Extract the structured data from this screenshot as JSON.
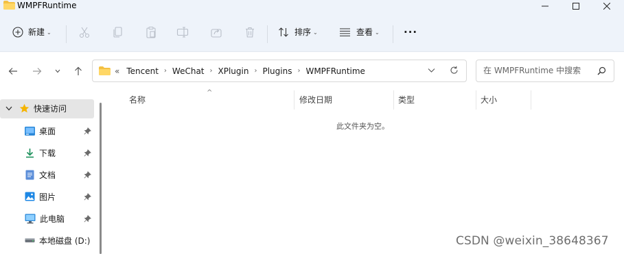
{
  "window": {
    "title": "WMPFRuntime"
  },
  "toolbar": {
    "new_label": "新建",
    "sort_label": "排序",
    "view_label": "查看",
    "more_label": "···"
  },
  "address": {
    "overflow": "«",
    "crumbs": [
      "Tencent",
      "WeChat",
      "XPlugin",
      "Plugins",
      "WMPFRuntime"
    ]
  },
  "search": {
    "placeholder": "在 WMPFRuntime 中搜索"
  },
  "sidebar": {
    "quick_access": "快速访问",
    "items": [
      {
        "label": "桌面",
        "icon": "desktop-icon",
        "pinned": true
      },
      {
        "label": "下载",
        "icon": "download-icon",
        "pinned": true
      },
      {
        "label": "文档",
        "icon": "document-icon",
        "pinned": true
      },
      {
        "label": "图片",
        "icon": "picture-icon",
        "pinned": true
      },
      {
        "label": "此电脑",
        "icon": "computer-icon",
        "pinned": true
      },
      {
        "label": "本地磁盘 (D:)",
        "icon": "drive-icon",
        "pinned": false
      }
    ]
  },
  "columns": {
    "name": "名称",
    "date": "修改日期",
    "type": "类型",
    "size": "大小"
  },
  "content": {
    "empty_message": "此文件夹为空。"
  },
  "watermark": "CSDN @weixin_38648367",
  "colors": {
    "chrome_bg": "#eef3fa",
    "folder_yellow": "#f4c042",
    "quick_access_star": "#f5b400",
    "selected_row": "#e5e5e5",
    "accent_blue": "#1e88e5"
  }
}
